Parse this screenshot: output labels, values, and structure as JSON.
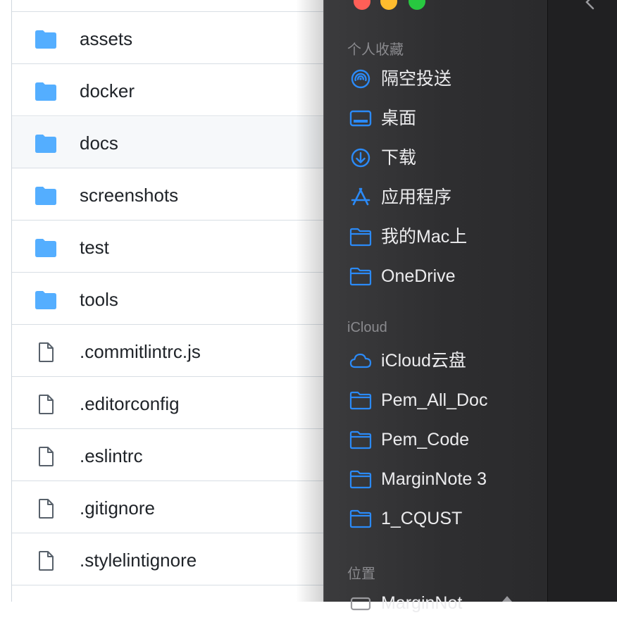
{
  "file_list": {
    "rows": [
      {
        "name": "assets",
        "type": "folder"
      },
      {
        "name": "docker",
        "type": "folder"
      },
      {
        "name": "docs",
        "type": "folder"
      },
      {
        "name": "screenshots",
        "type": "folder"
      },
      {
        "name": "test",
        "type": "folder"
      },
      {
        "name": "tools",
        "type": "folder"
      },
      {
        "name": ".commitlintrc.js",
        "type": "file"
      },
      {
        "name": ".editorconfig",
        "type": "file"
      },
      {
        "name": ".eslintrc",
        "type": "file"
      },
      {
        "name": ".gitignore",
        "type": "file"
      },
      {
        "name": ".stylelintignore",
        "type": "file"
      }
    ]
  },
  "sidebar": {
    "favorites_title": "个人收藏",
    "favorites": [
      {
        "label": "隔空投送",
        "icon": "airdrop-icon"
      },
      {
        "label": "桌面",
        "icon": "desktop-icon"
      },
      {
        "label": "下载",
        "icon": "download-icon"
      },
      {
        "label": "应用程序",
        "icon": "applications-icon"
      },
      {
        "label": "我的Mac上",
        "icon": "folder-icon"
      },
      {
        "label": "OneDrive",
        "icon": "folder-icon"
      }
    ],
    "icloud_title": "iCloud",
    "icloud": [
      {
        "label": "iCloud云盘",
        "icon": "cloud-icon"
      },
      {
        "label": "Pem_All_Doc",
        "icon": "folder-icon"
      },
      {
        "label": "Pem_Code",
        "icon": "folder-icon"
      },
      {
        "label": "MarginNote 3",
        "icon": "folder-icon"
      },
      {
        "label": "1_CQUST",
        "icon": "folder-icon"
      }
    ],
    "locations_title": "位置",
    "locations": [
      {
        "label": "MarginNot",
        "icon": "disk-icon"
      }
    ]
  },
  "colors": {
    "folder_blue": "#54aeff",
    "sidebar_accent": "#2b8af7",
    "close": "#ff5f57",
    "minimize": "#febc2e",
    "zoom": "#28c840"
  }
}
